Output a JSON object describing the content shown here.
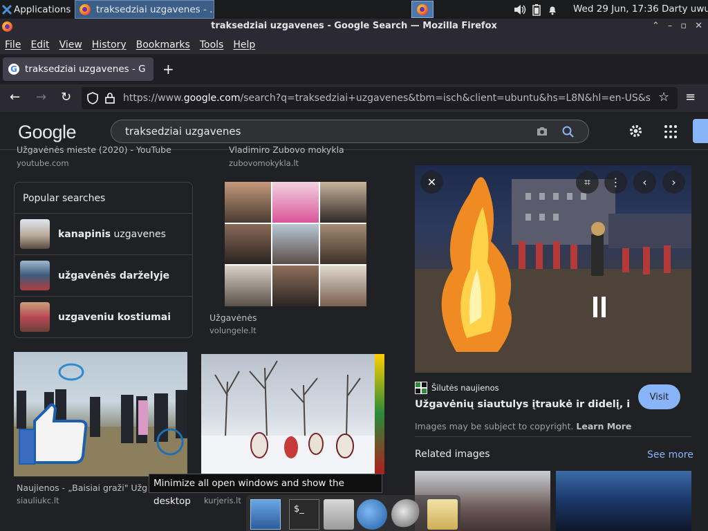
{
  "taskbar": {
    "apps_label": "Applications",
    "task_label": "traksedziai uzgavenes - ...",
    "clock": "Wed 29 Jun, 17:36",
    "user": "Darty uwu"
  },
  "window": {
    "title": "traksedziai uzgavenes - Google Search — Mozilla Firefox"
  },
  "menu": [
    "File",
    "Edit",
    "View",
    "History",
    "Bookmarks",
    "Tools",
    "Help"
  ],
  "tab": {
    "label": "traksedziai uzgavenes - G",
    "new_tab": "+"
  },
  "url": {
    "prefix": "https://www.",
    "domain": "google.com",
    "rest": "/search?q=traksedziai+uzgavenes&tbm=isch&client=ubuntu&hs=L8N&hl=en-US&s"
  },
  "google": {
    "logo": "Google",
    "query": "traksedziai uzgavenes"
  },
  "results": {
    "top_left_title": "Užgavėnės mieste (2020) - YouTube",
    "top_left_src": "youtube.com",
    "top_right_title": "Vladimiro Zubovo mokykla",
    "top_right_src": "zubovomokykla.lt",
    "collage_title": "Užgavėnės",
    "collage_src": "volungele.lt",
    "bottom_left_title": "Naujienos - „Baisiai graži\" Užgavėnių",
    "bottom_left_src": "siauliukc.lt",
    "bottom_right_src": "kurjeris.lt"
  },
  "popular": {
    "title": "Popular searches",
    "items": [
      {
        "bold": "kanapinis",
        "rest": " uzgavenes"
      },
      {
        "bold": "",
        "rest": "užgavėnės darželyje"
      },
      {
        "bold": "",
        "rest": "uzgaveniu kostiumai"
      }
    ]
  },
  "preview": {
    "source": "Šilutės naujienos",
    "title": "Užgavėnių siautulys įtraukė ir didelį, ir mažą ...",
    "visit": "Visit",
    "copyright": "Images may be subject to copyright.",
    "learn_more": "Learn More",
    "related": "Related images",
    "see_more": "See more"
  },
  "tooltip": "Minimize all open windows and show the desktop",
  "colors": {
    "background": "#202124",
    "accent": "#8ab4f8",
    "taskbar_active": "#3c5f8a"
  }
}
